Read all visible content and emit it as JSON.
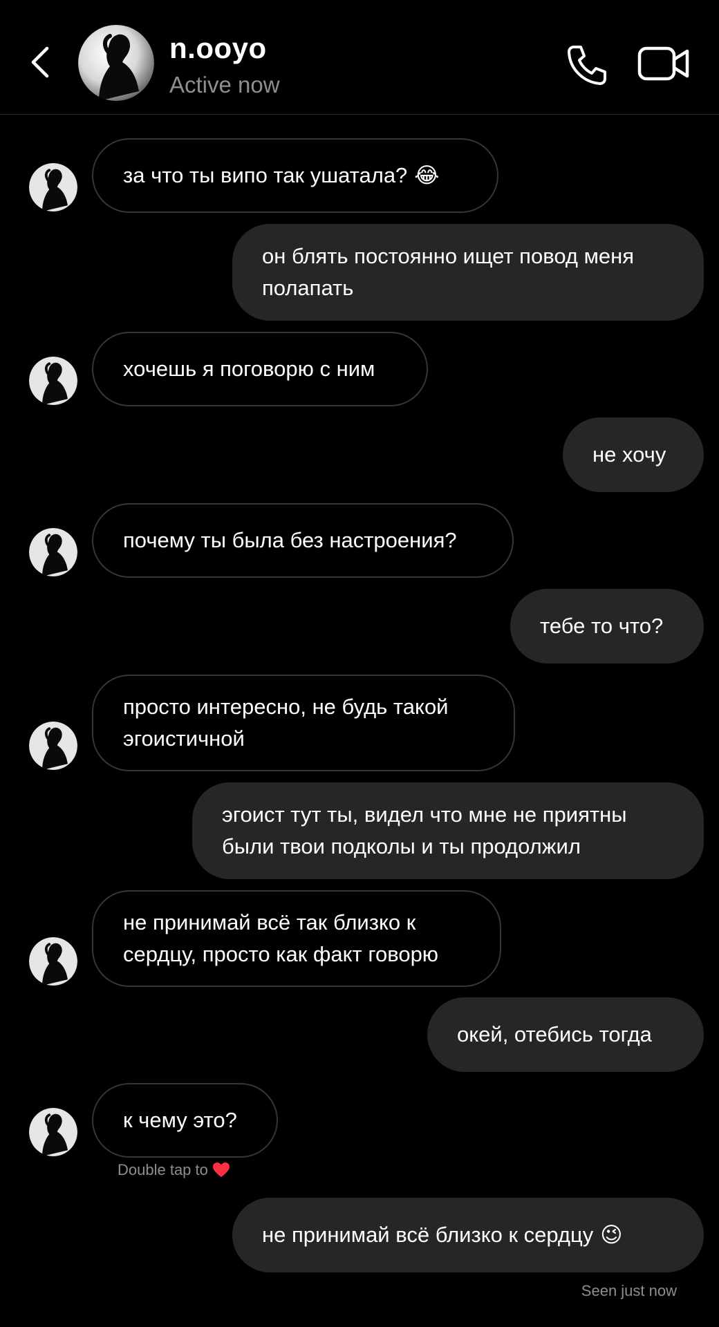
{
  "header": {
    "username": "n.ooyo",
    "status": "Active now"
  },
  "messages": [
    {
      "side": "in",
      "text": "за что ты випо так ушатала?",
      "emoji": "😂"
    },
    {
      "side": "out",
      "text": "он блять постоянно ищет повод меня\nполапать"
    },
    {
      "side": "in",
      "text": "хочешь я поговорю с ним"
    },
    {
      "side": "out",
      "text": "не хочу"
    },
    {
      "side": "in",
      "text": "почему ты была без настроения?"
    },
    {
      "side": "out",
      "text": "тебе то что?"
    },
    {
      "side": "in",
      "text": "просто интересно, не будь такой\nэгоистичной"
    },
    {
      "side": "out",
      "text": "эгоист тут ты, видел что мне не приятны\nбыли твои подколы и ты продолжил"
    },
    {
      "side": "in",
      "text": "не принимай всё так близко к\nсердцу, просто как факт говорю"
    },
    {
      "side": "out",
      "text": "окей, отебись тогда"
    },
    {
      "side": "in",
      "text": "к чему это?"
    },
    {
      "side": "out",
      "text": "не принимай всё близко к сердцу",
      "emoji": "😉"
    }
  ],
  "hint": {
    "text": "Double tap to",
    "icon": "heart-icon",
    "color": "#ff3040"
  },
  "seen_text": "Seen just now",
  "colors": {
    "background": "#000000",
    "outgoing_bubble": "#262626",
    "incoming_border": "#363636",
    "muted_text": "#8e8e8e"
  }
}
